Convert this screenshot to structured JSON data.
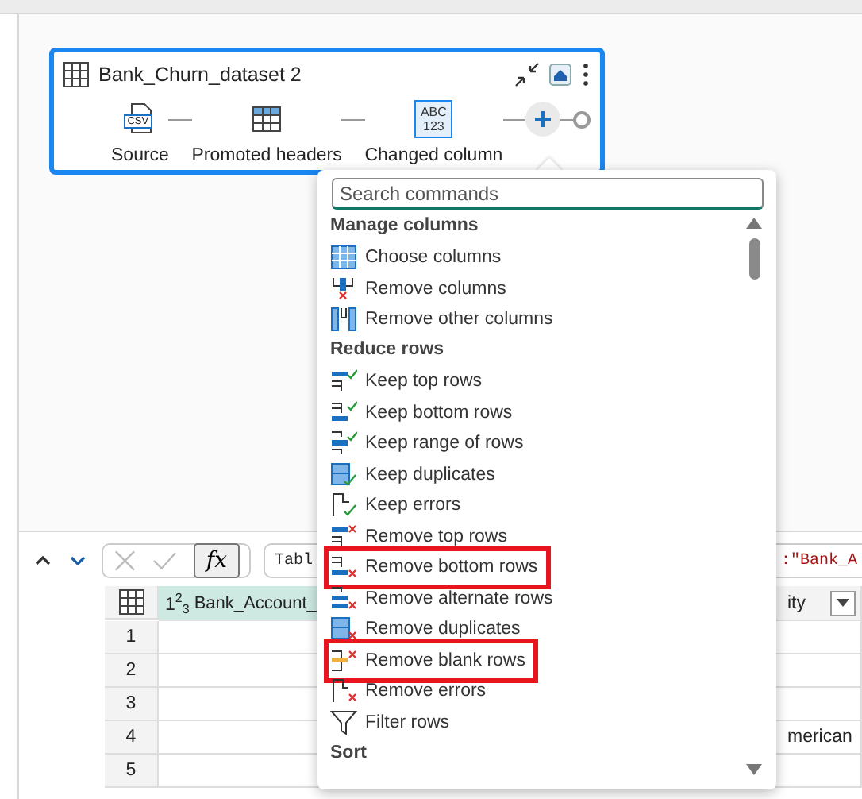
{
  "query_card": {
    "title": "Bank_Churn_dataset 2",
    "steps": [
      {
        "label": "Source",
        "selected": false,
        "icon_text": [
          "CSV"
        ]
      },
      {
        "label": "Promoted headers",
        "selected": false
      },
      {
        "label": "Changed column",
        "selected": true,
        "icon_text": [
          "ABC",
          "123"
        ]
      }
    ]
  },
  "command_menu": {
    "search": {
      "placeholder": "Search commands"
    },
    "items": [
      {
        "kind": "section",
        "label": "Manage columns"
      },
      {
        "kind": "command",
        "label": "Choose columns",
        "highlighted": false
      },
      {
        "kind": "command",
        "label": "Remove columns",
        "highlighted": false
      },
      {
        "kind": "command",
        "label": "Remove other columns",
        "highlighted": false
      },
      {
        "kind": "section",
        "label": "Reduce rows"
      },
      {
        "kind": "command",
        "label": "Keep top rows",
        "highlighted": false
      },
      {
        "kind": "command",
        "label": "Keep bottom rows",
        "highlighted": false
      },
      {
        "kind": "command",
        "label": "Keep range of rows",
        "highlighted": false
      },
      {
        "kind": "command",
        "label": "Keep duplicates",
        "highlighted": false
      },
      {
        "kind": "command",
        "label": "Keep errors",
        "highlighted": false
      },
      {
        "kind": "command",
        "label": "Remove top rows",
        "highlighted": false
      },
      {
        "kind": "command",
        "label": "Remove bottom rows",
        "highlighted": true
      },
      {
        "kind": "command",
        "label": "Remove alternate rows",
        "highlighted": false
      },
      {
        "kind": "command",
        "label": "Remove duplicates",
        "highlighted": false
      },
      {
        "kind": "command",
        "label": "Remove blank rows",
        "highlighted": true
      },
      {
        "kind": "command",
        "label": "Remove errors",
        "highlighted": false
      },
      {
        "kind": "command",
        "label": "Filter rows",
        "highlighted": false
      },
      {
        "kind": "section",
        "label": "Sort"
      }
    ]
  },
  "formula_bar": {
    "fx": "fx",
    "formula_start": "Tabl",
    "formula_end": ":\"Bank_A"
  },
  "table": {
    "columns": [
      {
        "type": "1$^{2}$$_{3}$",
        "name": "Bank_Account_"
      },
      {
        "name": "ity",
        "filter": true
      }
    ],
    "rows": [
      {
        "number": "1"
      },
      {
        "number": "2"
      },
      {
        "number": "3"
      },
      {
        "number": "4",
        "column_4": "merican"
      },
      {
        "number": "5"
      }
    ]
  }
}
